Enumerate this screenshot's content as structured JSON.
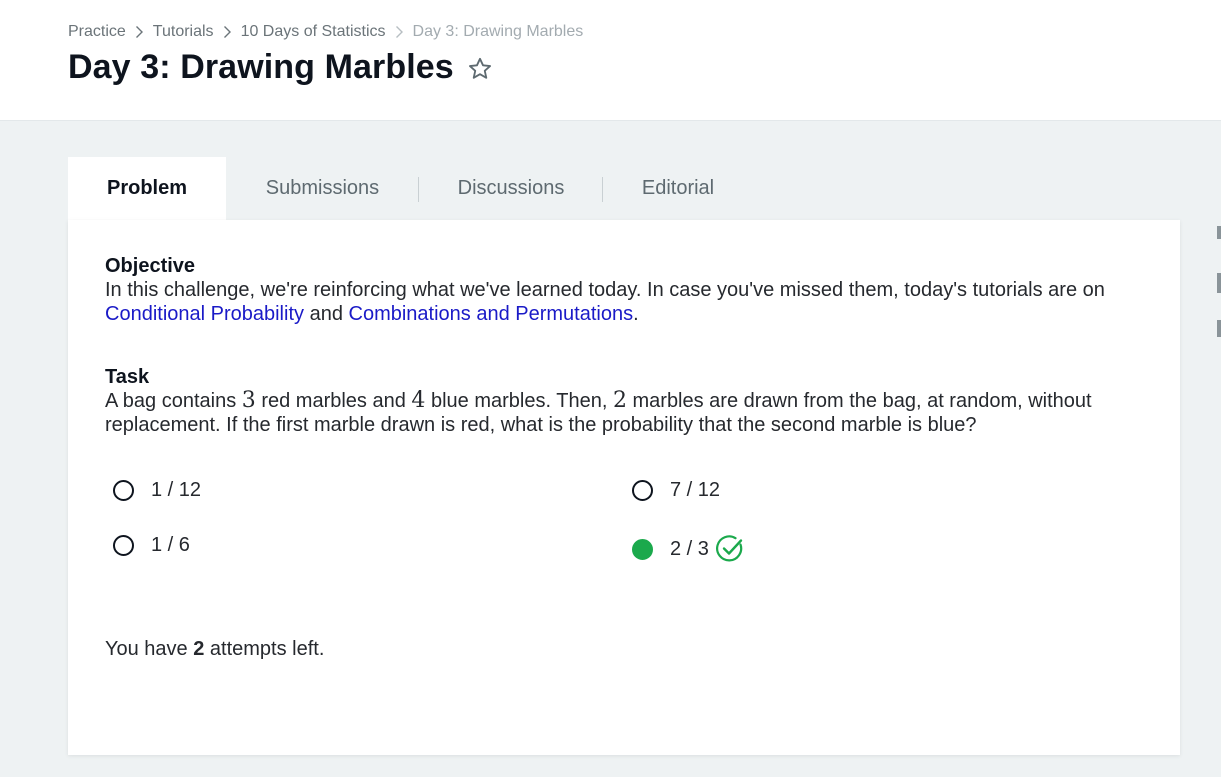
{
  "breadcrumb": {
    "items": [
      "Practice",
      "Tutorials",
      "10 Days of Statistics"
    ],
    "current": "Day 3: Drawing Marbles"
  },
  "page": {
    "title": "Day 3: Drawing Marbles",
    "star_icon": "star-outline-icon"
  },
  "tabs": [
    {
      "label": "Problem",
      "active": true
    },
    {
      "label": "Submissions",
      "active": false
    },
    {
      "label": "Discussions",
      "active": false
    },
    {
      "label": "Editorial",
      "active": false
    }
  ],
  "problem": {
    "objective_heading": "Objective",
    "objective_text_1": "In this challenge, we're reinforcing what we've learned today. In case you've missed them, today's tutorials are on ",
    "link_1": "Conditional Probability",
    "objective_and": " and ",
    "link_2": "Combinations and Permutations",
    "objective_end": ".",
    "task_heading": "Task",
    "task_p1": "A bag contains ",
    "task_n1": "3",
    "task_p2": " red marbles and ",
    "task_n2": "4",
    "task_p3": " blue marbles. Then, ",
    "task_n3": "2",
    "task_p4": " marbles are drawn from the bag, at random, without replacement. If the first marble drawn is red, what is the probability that the second marble is blue?"
  },
  "options": [
    {
      "label": "1 / 12",
      "selected": false
    },
    {
      "label": "7 / 12",
      "selected": false
    },
    {
      "label": "1 / 6",
      "selected": false
    },
    {
      "label": "2 / 3",
      "selected": true,
      "correct": true
    }
  ],
  "attempts": {
    "prefix": "You have ",
    "count": "2",
    "suffix": " attempts left."
  },
  "colors": {
    "accent_green": "#1ba94c",
    "link_blue": "#1a1ac7",
    "background": "#eef2f3"
  }
}
